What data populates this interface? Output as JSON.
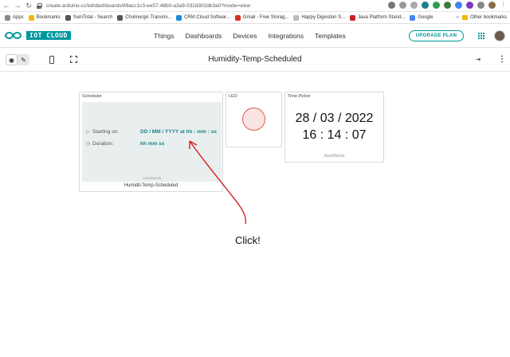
{
  "browser": {
    "url": "create.arduino.cc/iot/dashboards/69acc1c3-ee57-48b0-a3a9-032d302db3a0?mode=view",
    "bookmarks": [
      {
        "label": "Apps",
        "color": "#4a7bd0"
      },
      {
        "label": "Bookmarks",
        "color": "#f2b705"
      },
      {
        "label": "SumTotal - Search",
        "color": "#555555"
      },
      {
        "label": "Cholinergic Transmi...",
        "color": "#555555"
      },
      {
        "label": "CRM Cloud Softwar...",
        "color": "#1a8cd8"
      },
      {
        "label": "Gmail - Free Storag...",
        "color": "#d93025"
      },
      {
        "label": "Happy Digestion S...",
        "color": "#999999"
      },
      {
        "label": "Java Platform Stand...",
        "color": "#cc2222"
      },
      {
        "label": "Google",
        "color": "#4285f4"
      }
    ],
    "other_bookmarks": "Other bookmarks"
  },
  "header": {
    "logo_text": "IOT CLOUD",
    "nav": [
      "Things",
      "Dashboards",
      "Devices",
      "Integrations",
      "Templates"
    ],
    "upgrade_label": "UPGRADE PLAN",
    "accent": "#00979d"
  },
  "dashboard": {
    "title": "Humidity-Temp-Scheduled"
  },
  "widgets": {
    "scheduler": {
      "label": "Scheduler",
      "starting_label": "Starting on:",
      "starting_value": "DD / MM / YYYY at hh : mm : ss",
      "duration_label": "Duration:",
      "duration_value": "hh mm ss",
      "timezone": "Asia/Manila",
      "name": "Humidit-Temp-Scheduled"
    },
    "led": {
      "label": "LED",
      "color": "#e05a4e"
    },
    "time_picker": {
      "label": "Time Picker",
      "date": "28 / 03 / 2022",
      "time": "16 : 14 : 07",
      "timezone": "Asia/Manila"
    }
  },
  "annotation": {
    "text": "Click!",
    "color": "#d42020"
  }
}
